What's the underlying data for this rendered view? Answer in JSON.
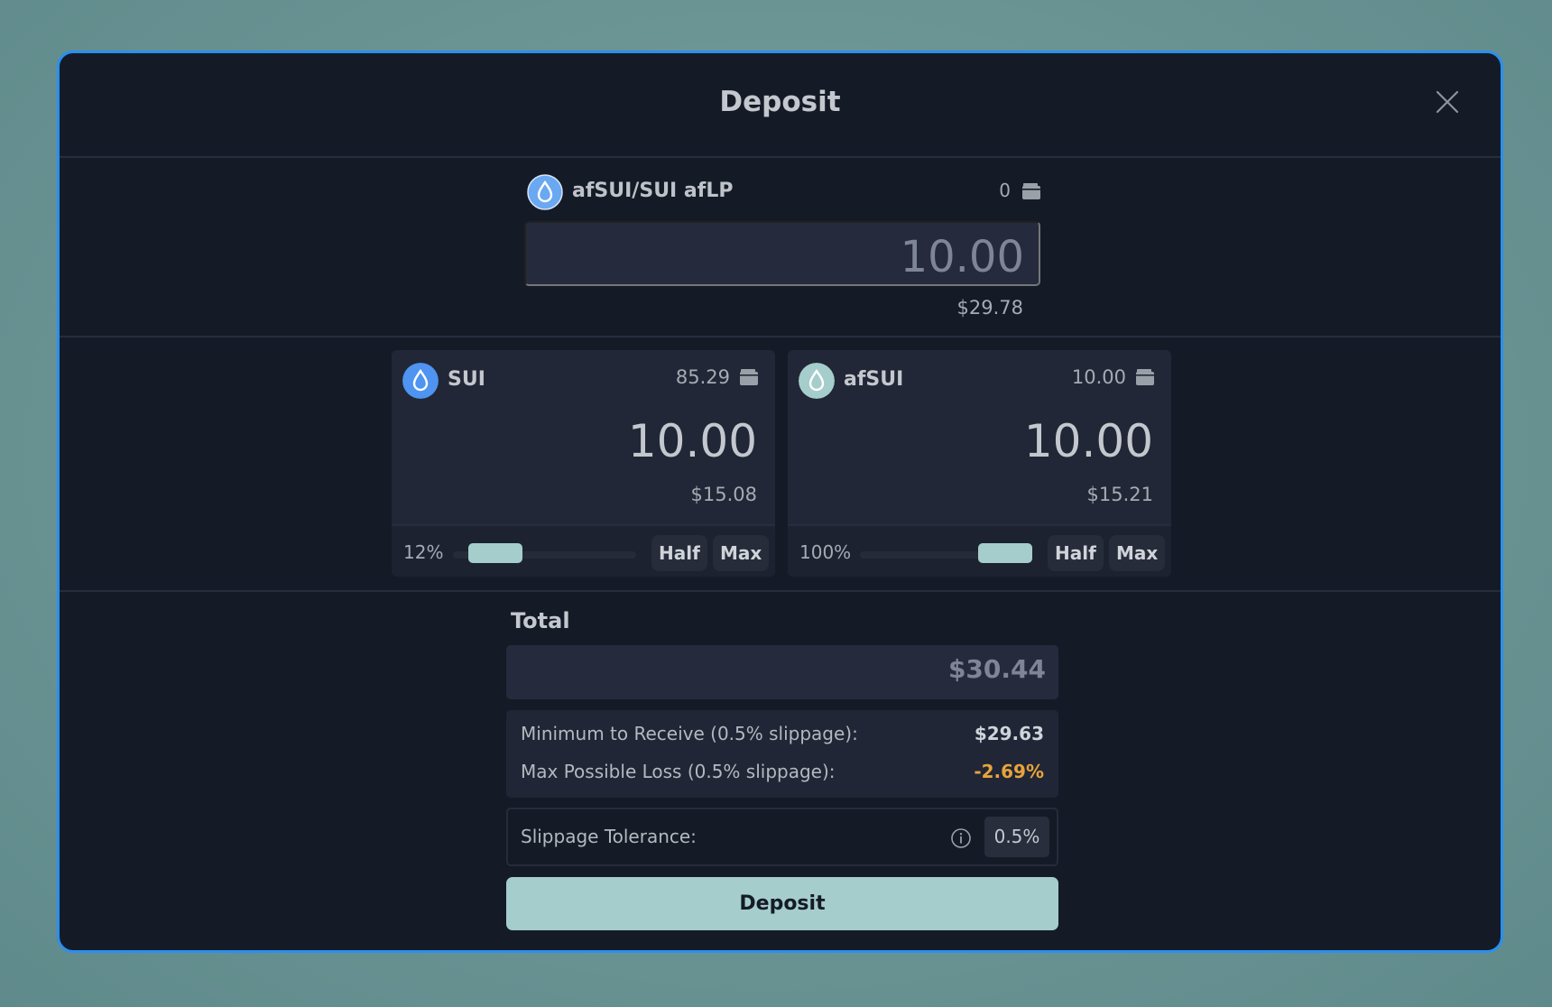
{
  "modal": {
    "title": "Deposit",
    "close_icon": "close-icon"
  },
  "lp": {
    "name": "afSUI/SUI afLP",
    "balance": "0",
    "amount": "10.00",
    "usd": "$29.78",
    "icon": "droplet-icon",
    "icon_color": "#6aa8f2"
  },
  "coins": [
    {
      "name": "SUI",
      "balance": "85.29",
      "amount": "10.00",
      "usd": "$15.08",
      "percent_label": "12%",
      "percent": 12,
      "half_label": "Half",
      "max_label": "Max",
      "icon": "droplet-icon",
      "icon_color": "#4e94f0"
    },
    {
      "name": "afSUI",
      "balance": "10.00",
      "amount": "10.00",
      "usd": "$15.21",
      "percent_label": "100%",
      "percent": 100,
      "half_label": "Half",
      "max_label": "Max",
      "icon": "droplet-icon",
      "icon_color": "#a5cdcc"
    }
  ],
  "total": {
    "label": "Total",
    "value": "$30.44"
  },
  "summary": {
    "min_receive_label": "Minimum to Receive (0.5% slippage):",
    "min_receive_value": "$29.63",
    "max_loss_label": "Max Possible Loss (0.5% slippage):",
    "max_loss_value": "-2.69%",
    "max_loss_color": "#e8a33a"
  },
  "slippage": {
    "label": "Slippage Tolerance:",
    "value": "0.5%",
    "info_icon": "info-icon"
  },
  "deposit_button": "Deposit",
  "colors": {
    "accent": "#a5cdcc",
    "modal_border": "#2a8ff0",
    "modal_bg": "#141b27"
  }
}
